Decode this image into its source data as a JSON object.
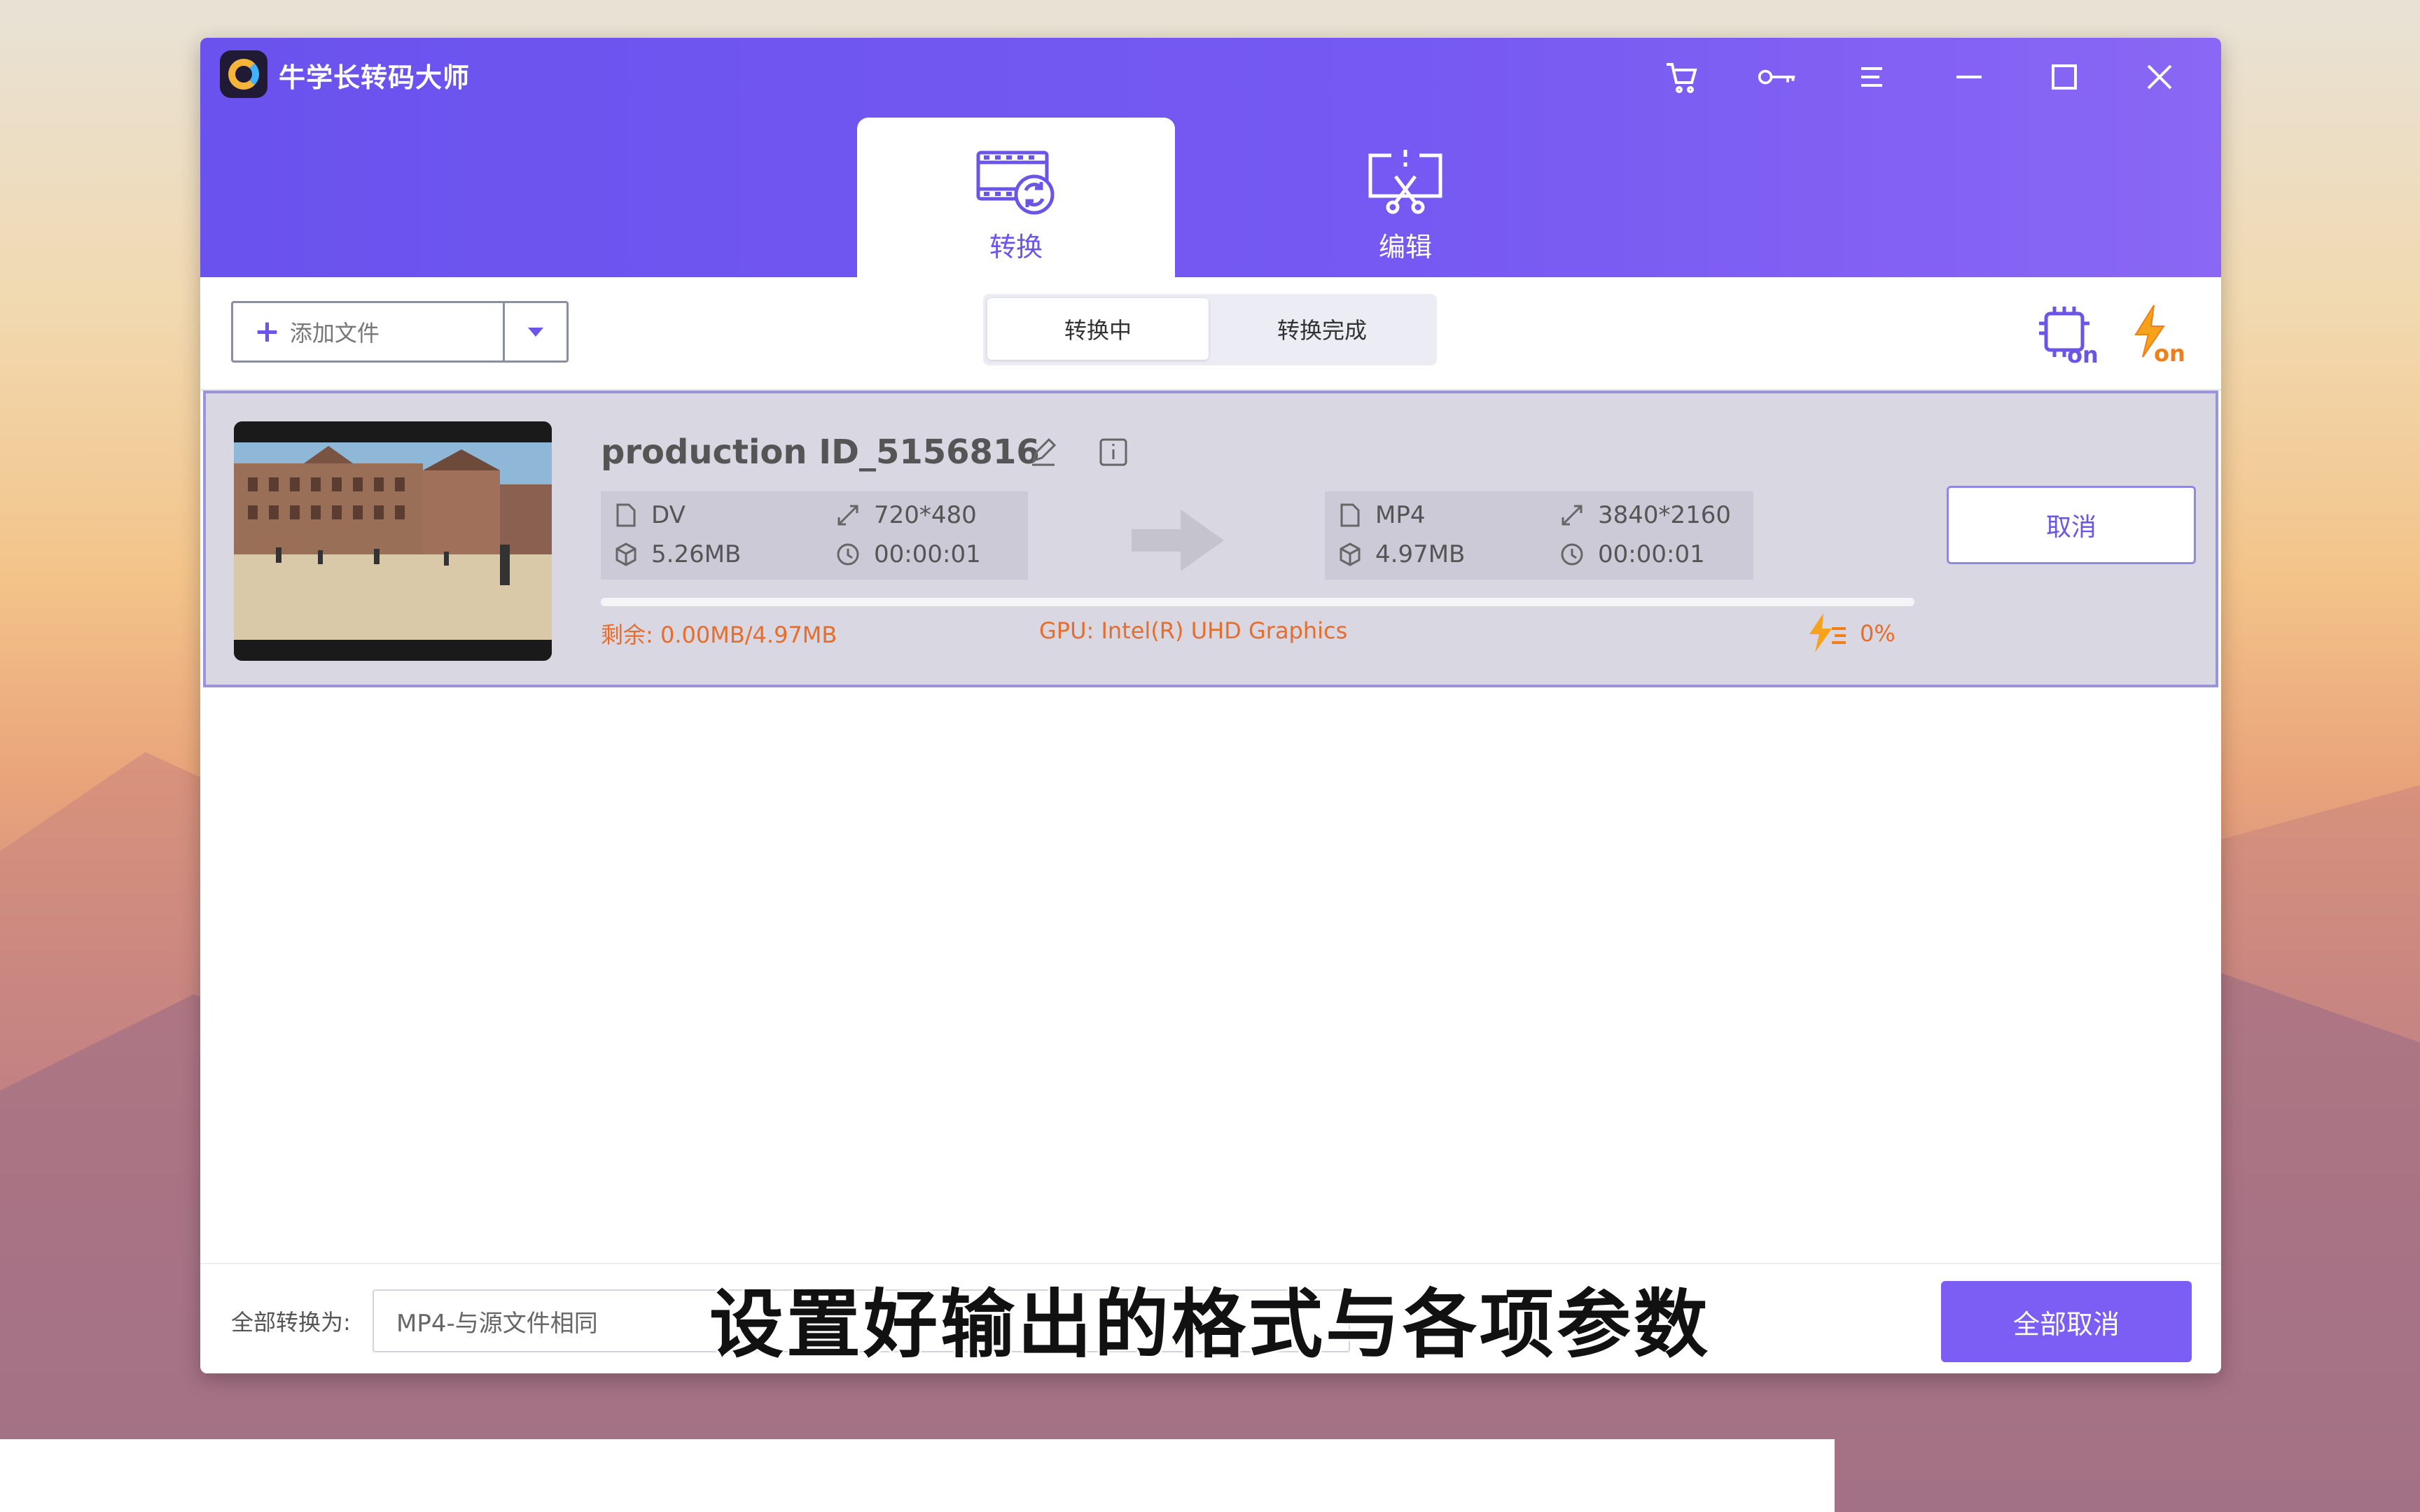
{
  "app": {
    "title": "牛学长转码大师"
  },
  "window_controls": [
    "cart-icon",
    "key-icon",
    "menu-icon",
    "minimize-icon",
    "maximize-icon",
    "close-icon"
  ],
  "tabs": [
    {
      "label": "转换",
      "icon": "film-convert-icon",
      "active": true
    },
    {
      "label": "编辑",
      "icon": "edit-scissors-icon",
      "active": false
    }
  ],
  "toolbar": {
    "add_file_label": "添加文件",
    "segments": [
      {
        "label": "转换中",
        "active": true
      },
      {
        "label": "转换完成",
        "active": false
      }
    ],
    "hw_accel_badge": "on",
    "flash_badge": "on"
  },
  "file": {
    "name": "production ID_5156816",
    "source": {
      "format": "DV",
      "resolution": "720*480",
      "size": "5.26MB",
      "duration": "00:00:01"
    },
    "target": {
      "format": "MP4",
      "resolution": "3840*2160",
      "size": "4.97MB",
      "duration": "00:00:01"
    },
    "cancel_label": "取消",
    "remaining": "剩余: 0.00MB/4.97MB",
    "gpu": "GPU: Intel(R) UHD Graphics",
    "progress_percent": "0%",
    "progress_value": 0
  },
  "footer": {
    "convert_all_label": "全部转换为:",
    "format_value": "MP4-与源文件相同",
    "cancel_all_label": "全部取消"
  },
  "subtitle": "设置好输出的格式与各项参数",
  "colors": {
    "accent": "#6b55e8",
    "titlebar": "#7659f2",
    "warning_text": "#e66d2c"
  }
}
